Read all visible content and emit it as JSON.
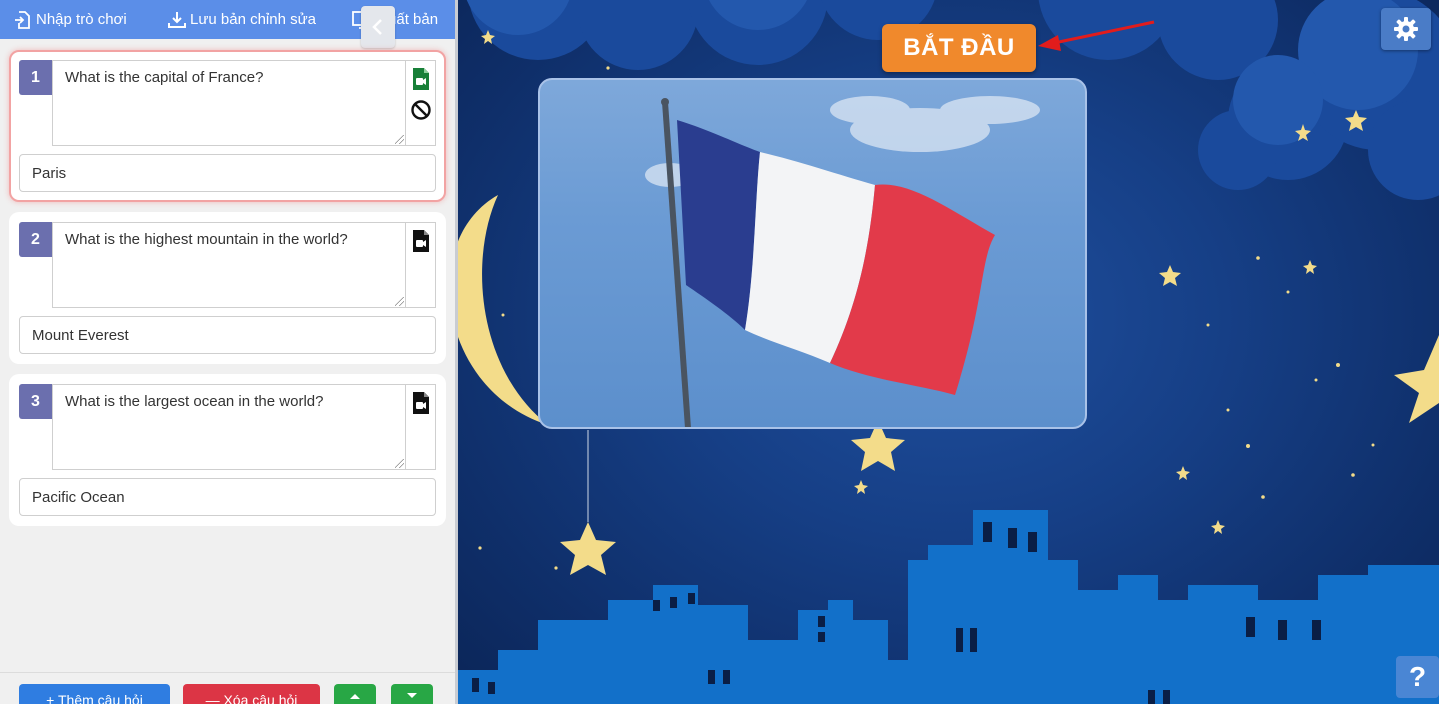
{
  "toolbar": {
    "import_label": "Nhập trò chơi",
    "save_label": "Lưu bản chỉnh sửa",
    "export_label": "Xuất bản"
  },
  "questions": [
    {
      "number": "1",
      "question": "What is the capital of France?",
      "answer": "Paris",
      "active": true
    },
    {
      "number": "2",
      "question": "What is the highest mountain in the world?",
      "answer": "Mount Everest",
      "active": false
    },
    {
      "number": "3",
      "question": "What is the largest ocean in the world?",
      "answer": "Pacific Ocean",
      "active": false
    }
  ],
  "bottom_bar": {
    "add_label": "+ Thêm câu hỏi",
    "delete_label": "— Xóa câu hỏi"
  },
  "stage": {
    "start_label": "BẮT ĐẦU",
    "help_label": "?"
  },
  "colors": {
    "toolbar": "#5b8ee8",
    "question_number": "#6b6fae",
    "start_button": "#f0892c",
    "add_button": "#2f7de1",
    "delete_button": "#dc3545",
    "move_buttons": "#28a745",
    "active_border": "#f2a3a3"
  },
  "icons": {
    "import": "file-import-icon",
    "save": "download-icon",
    "export": "monitor-icon",
    "collapse": "chevron-left-icon",
    "video": "video-file-icon",
    "remove_media": "ban-icon",
    "settings": "gear-icon",
    "move_up": "caret-up-icon",
    "move_down": "caret-down-icon"
  }
}
